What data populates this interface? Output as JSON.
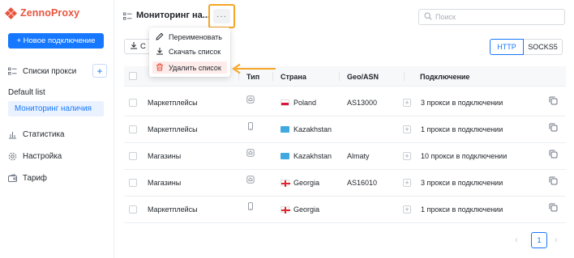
{
  "brand": {
    "name": "ZennoProxy",
    "color": "#e8553f"
  },
  "sidebar": {
    "new_button": "+ Новое подключение",
    "proxy_lists_label": "Списки прокси",
    "lists": [
      "Default list",
      "Мониторинг наличия"
    ],
    "selected_list": "Мониторинг наличия",
    "nav": [
      {
        "label": "Статистика",
        "icon": "bar-chart-icon"
      },
      {
        "label": "Настройка",
        "icon": "gear-icon"
      },
      {
        "label": "Тариф",
        "icon": "wallet-icon"
      }
    ]
  },
  "header": {
    "title": "Мониторинг на...",
    "more_label": "···",
    "search_placeholder": "Поиск"
  },
  "toolbar": {
    "download_label": "С",
    "protocols": [
      "HTTP",
      "SOCKS5"
    ],
    "active_protocol": "HTTP"
  },
  "menu": {
    "items": [
      {
        "label": "Переименовать",
        "icon": "pencil-icon"
      },
      {
        "label": "Скачать список",
        "icon": "download-icon"
      },
      {
        "label": "Удалить список",
        "icon": "trash-icon"
      }
    ]
  },
  "table": {
    "columns": [
      "",
      "Тип",
      "Страна",
      "Geo/ASN",
      "Подключение"
    ],
    "rows": [
      {
        "category": "Маркетплейсы",
        "type": "home-icon",
        "country": "Poland",
        "flag": "pl",
        "geo": "AS13000",
        "connection": "3 прокси в подключении"
      },
      {
        "category": "Маркетплейсы",
        "type": "mobile-icon",
        "country": "Kazakhstan",
        "flag": "kz",
        "geo": "",
        "connection": "1 прокси в подключении"
      },
      {
        "category": "Магазины",
        "type": "home-icon",
        "country": "Kazakhstan",
        "flag": "kz",
        "geo": "Almaty",
        "connection": "10 прокси в подключении"
      },
      {
        "category": "Магазины",
        "type": "home-icon",
        "country": "Georgia",
        "flag": "ge",
        "geo": "AS16010",
        "connection": "3 прокси в подключении"
      },
      {
        "category": "Маркетплейсы",
        "type": "mobile-icon",
        "country": "Georgia",
        "flag": "ge",
        "geo": "",
        "connection": "1 прокси в подключении"
      }
    ]
  },
  "pagination": {
    "current": "1",
    "prev": "‹",
    "next": "›"
  },
  "colors": {
    "accent": "#1677ff",
    "highlight": "#f5a623",
    "danger": "#e8553f"
  }
}
